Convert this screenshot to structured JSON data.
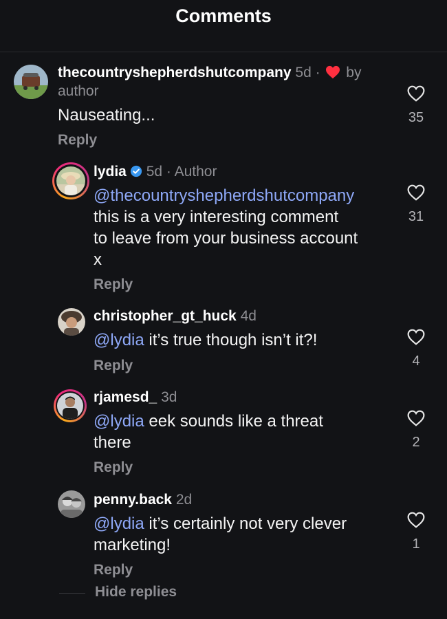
{
  "header": {
    "title": "Comments"
  },
  "comments": [
    {
      "username": "thecountryshepherdshutcompany",
      "time": "5d",
      "separator": "·",
      "by_label": "by",
      "author_label": "author",
      "text": "Nauseating...",
      "reply_label": "Reply",
      "likes": "35"
    },
    {
      "username": "lydia",
      "time": "5d",
      "separator": "·",
      "role": "Author",
      "mention": "@thecountryshepherdshutcompany",
      "text_lines": [
        "this is a very interesting comment",
        "to leave from your business account",
        "x"
      ],
      "reply_label": "Reply",
      "likes": "31"
    },
    {
      "username": "christopher_gt_huck",
      "time": "4d",
      "mention": "@lydia",
      "text": " it’s true though isn’t it?!",
      "reply_label": "Reply",
      "likes": "4"
    },
    {
      "username": "rjamesd_",
      "time": "3d",
      "mention": "@lydia",
      "text": " eek sounds like a threat",
      "text2": "there",
      "reply_label": "Reply",
      "likes": "2"
    },
    {
      "username": "penny.back",
      "time": "2d",
      "mention": "@lydia",
      "text": " it’s certainly not very clever",
      "text2": "marketing!",
      "reply_label": "Reply",
      "likes": "1"
    }
  ],
  "hide_replies": "Hide replies",
  "colors": {
    "background": "#121316",
    "mention": "#8ea8f7",
    "liked_heart": "#ff3040",
    "verified": "#3897f0"
  }
}
